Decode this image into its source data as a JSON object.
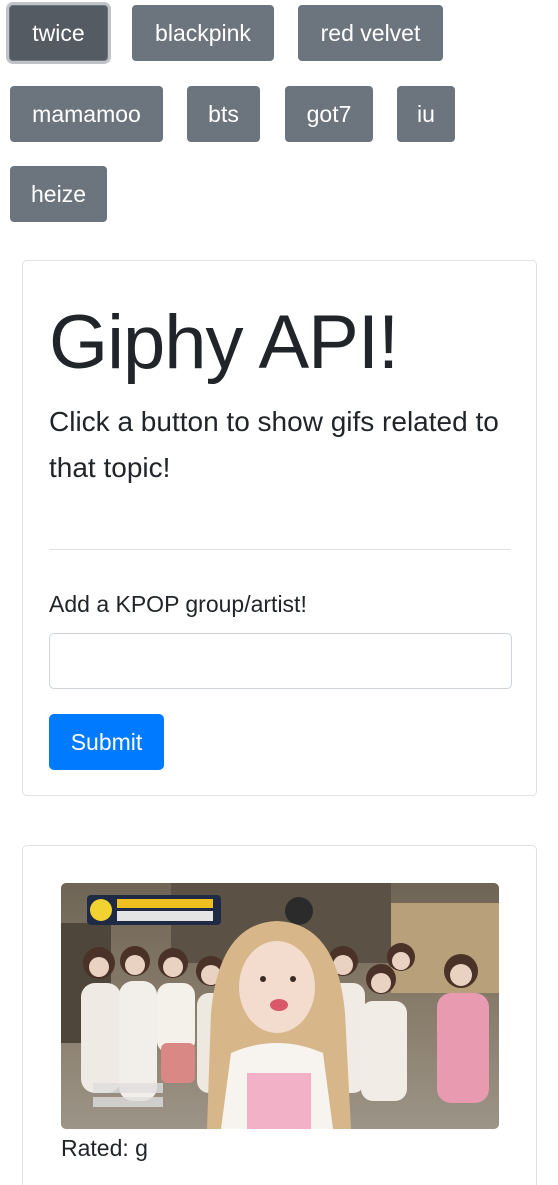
{
  "topics": [
    {
      "label": "twice",
      "active": true
    },
    {
      "label": "blackpink",
      "active": false
    },
    {
      "label": "red velvet",
      "active": false
    },
    {
      "label": "mamamoo",
      "active": false
    },
    {
      "label": "bts",
      "active": false
    },
    {
      "label": "got7",
      "active": false
    },
    {
      "label": "iu",
      "active": false
    },
    {
      "label": "heize",
      "active": false
    }
  ],
  "jumbotron": {
    "title": "Giphy API!",
    "lead": "Click a button to show gifs related to that topic!"
  },
  "form": {
    "label": "Add a KPOP group/artist!",
    "input_value": "",
    "submit_label": "Submit"
  },
  "results": [
    {
      "rating_text": "Rated: g"
    }
  ],
  "colors": {
    "button_secondary": "#6c757d",
    "button_primary": "#007bff",
    "card_border": "#dee2e6"
  }
}
